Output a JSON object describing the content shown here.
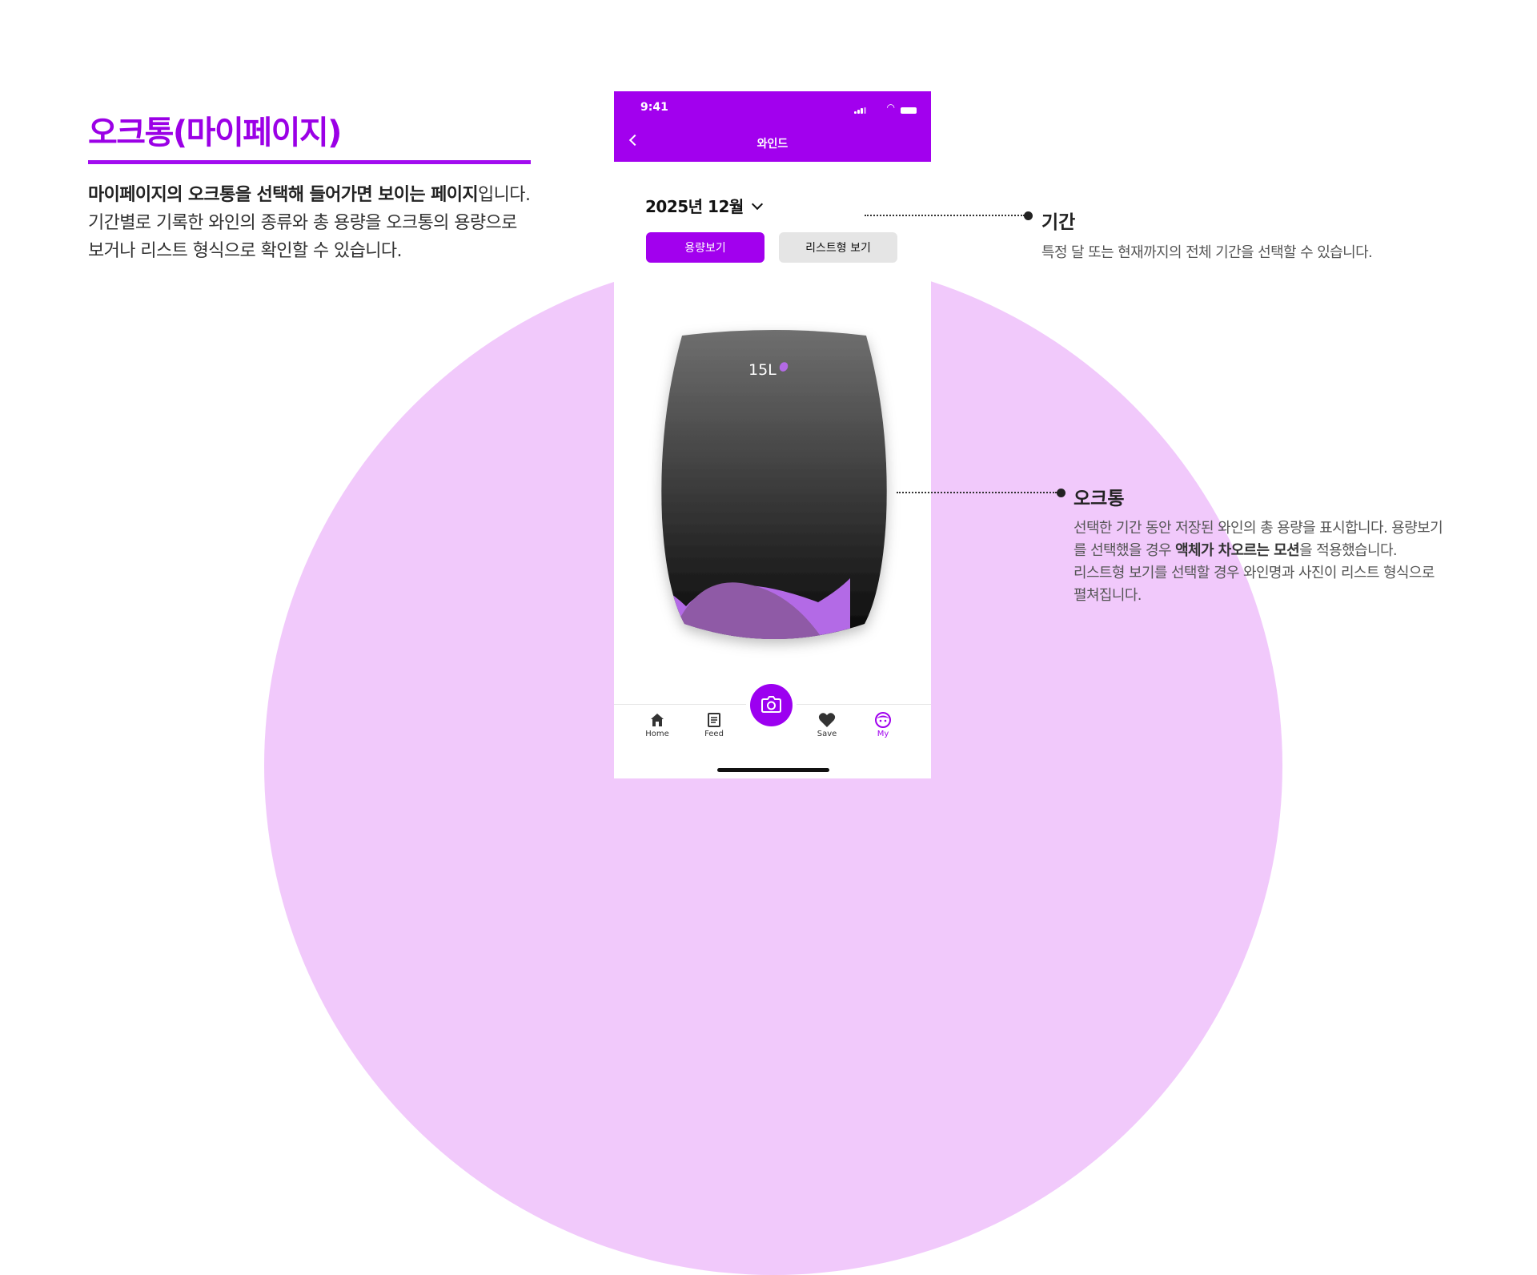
{
  "page": {
    "title": "오크통(마이페이지)",
    "desc_bold": "마이페이지의 오크통을 선택해 들어가면 보이는 페이지",
    "desc_rest": "입니다.",
    "desc_line2": "기간별로 기록한 와인의 종류와 총 용량을 오크통의 용량으로",
    "desc_line3": "보거나 리스트 형식으로 확인할 수 있습니다."
  },
  "phone": {
    "status_time": "9:41",
    "header_title": "와인드",
    "period": "2025년 12월",
    "buttons": {
      "volume": "용량보기",
      "list": "리스트형 보기"
    },
    "barrel_volume": "15L",
    "tabs": [
      {
        "label": "Home",
        "icon": "home-icon"
      },
      {
        "label": "Feed",
        "icon": "feed-icon"
      },
      {
        "label": "Save",
        "icon": "heart-icon"
      },
      {
        "label": "My",
        "icon": "profile-icon"
      }
    ],
    "active_tab": "My",
    "colors": {
      "accent": "#a200ee",
      "barrel_top": "#6f6f6f",
      "barrel_bottom": "#0a0a0a",
      "wine": "#8f5aa6",
      "background_circle": "#f1c9fb"
    }
  },
  "annotations": {
    "period": {
      "title": "기간",
      "text": "특정 달 또는 현재까지의 전체 기간을 선택할 수 있습니다."
    },
    "barrel": {
      "title": "오크통",
      "line1": "선택한 기간 동안 저장된 와인의 총 용량을 표시합니다. 용량보기",
      "line2_pre": "를 선택했을 경우 ",
      "line2_bold": "액체가 차오르는 모션",
      "line2_post": "을 적용했습니다.",
      "line3": "리스트형 보기를 선택할 경우 와인명과 사진이 리스트 형식으로",
      "line4": "펼쳐집니다."
    }
  }
}
